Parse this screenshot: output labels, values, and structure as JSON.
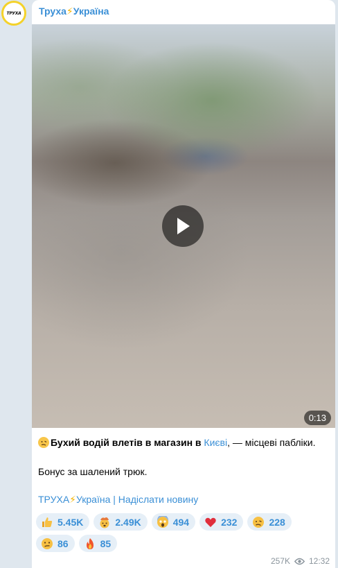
{
  "channel": {
    "name_part1": "Труха",
    "name_bolt": "⚡",
    "name_part2": "Україна",
    "avatar_text": "ТРУХА"
  },
  "video": {
    "duration": "0:13"
  },
  "post": {
    "headline_bold": "Бухий водій влетів в магазин в ",
    "headline_link": "Києві",
    "headline_rest": ", — місцеві пабліки.",
    "bonus_line": "Бонус за шалений трюк.",
    "footer_channel_part1": "ТРУХА",
    "footer_bolt": "⚡",
    "footer_channel_part2": "Україна",
    "footer_separator": " | ",
    "footer_submit": "Надіслати новину"
  },
  "reactions": [
    {
      "icon": "thumbs-up-icon",
      "count": "5.45K"
    },
    {
      "icon": "exploding-head-icon",
      "count": "2.49K"
    },
    {
      "icon": "screaming-face-icon",
      "count": "494"
    },
    {
      "icon": "red-heart-icon",
      "count": "232"
    },
    {
      "icon": "woozy-face-icon",
      "count": "228"
    },
    {
      "icon": "confused-face-icon",
      "count": "86"
    },
    {
      "icon": "fire-icon",
      "count": "85"
    }
  ],
  "meta": {
    "views": "257K",
    "time": "12:32"
  },
  "colors": {
    "accent": "#3a8fd6",
    "background": "#dfe7ee",
    "reaction_bg": "#e6eff7"
  }
}
